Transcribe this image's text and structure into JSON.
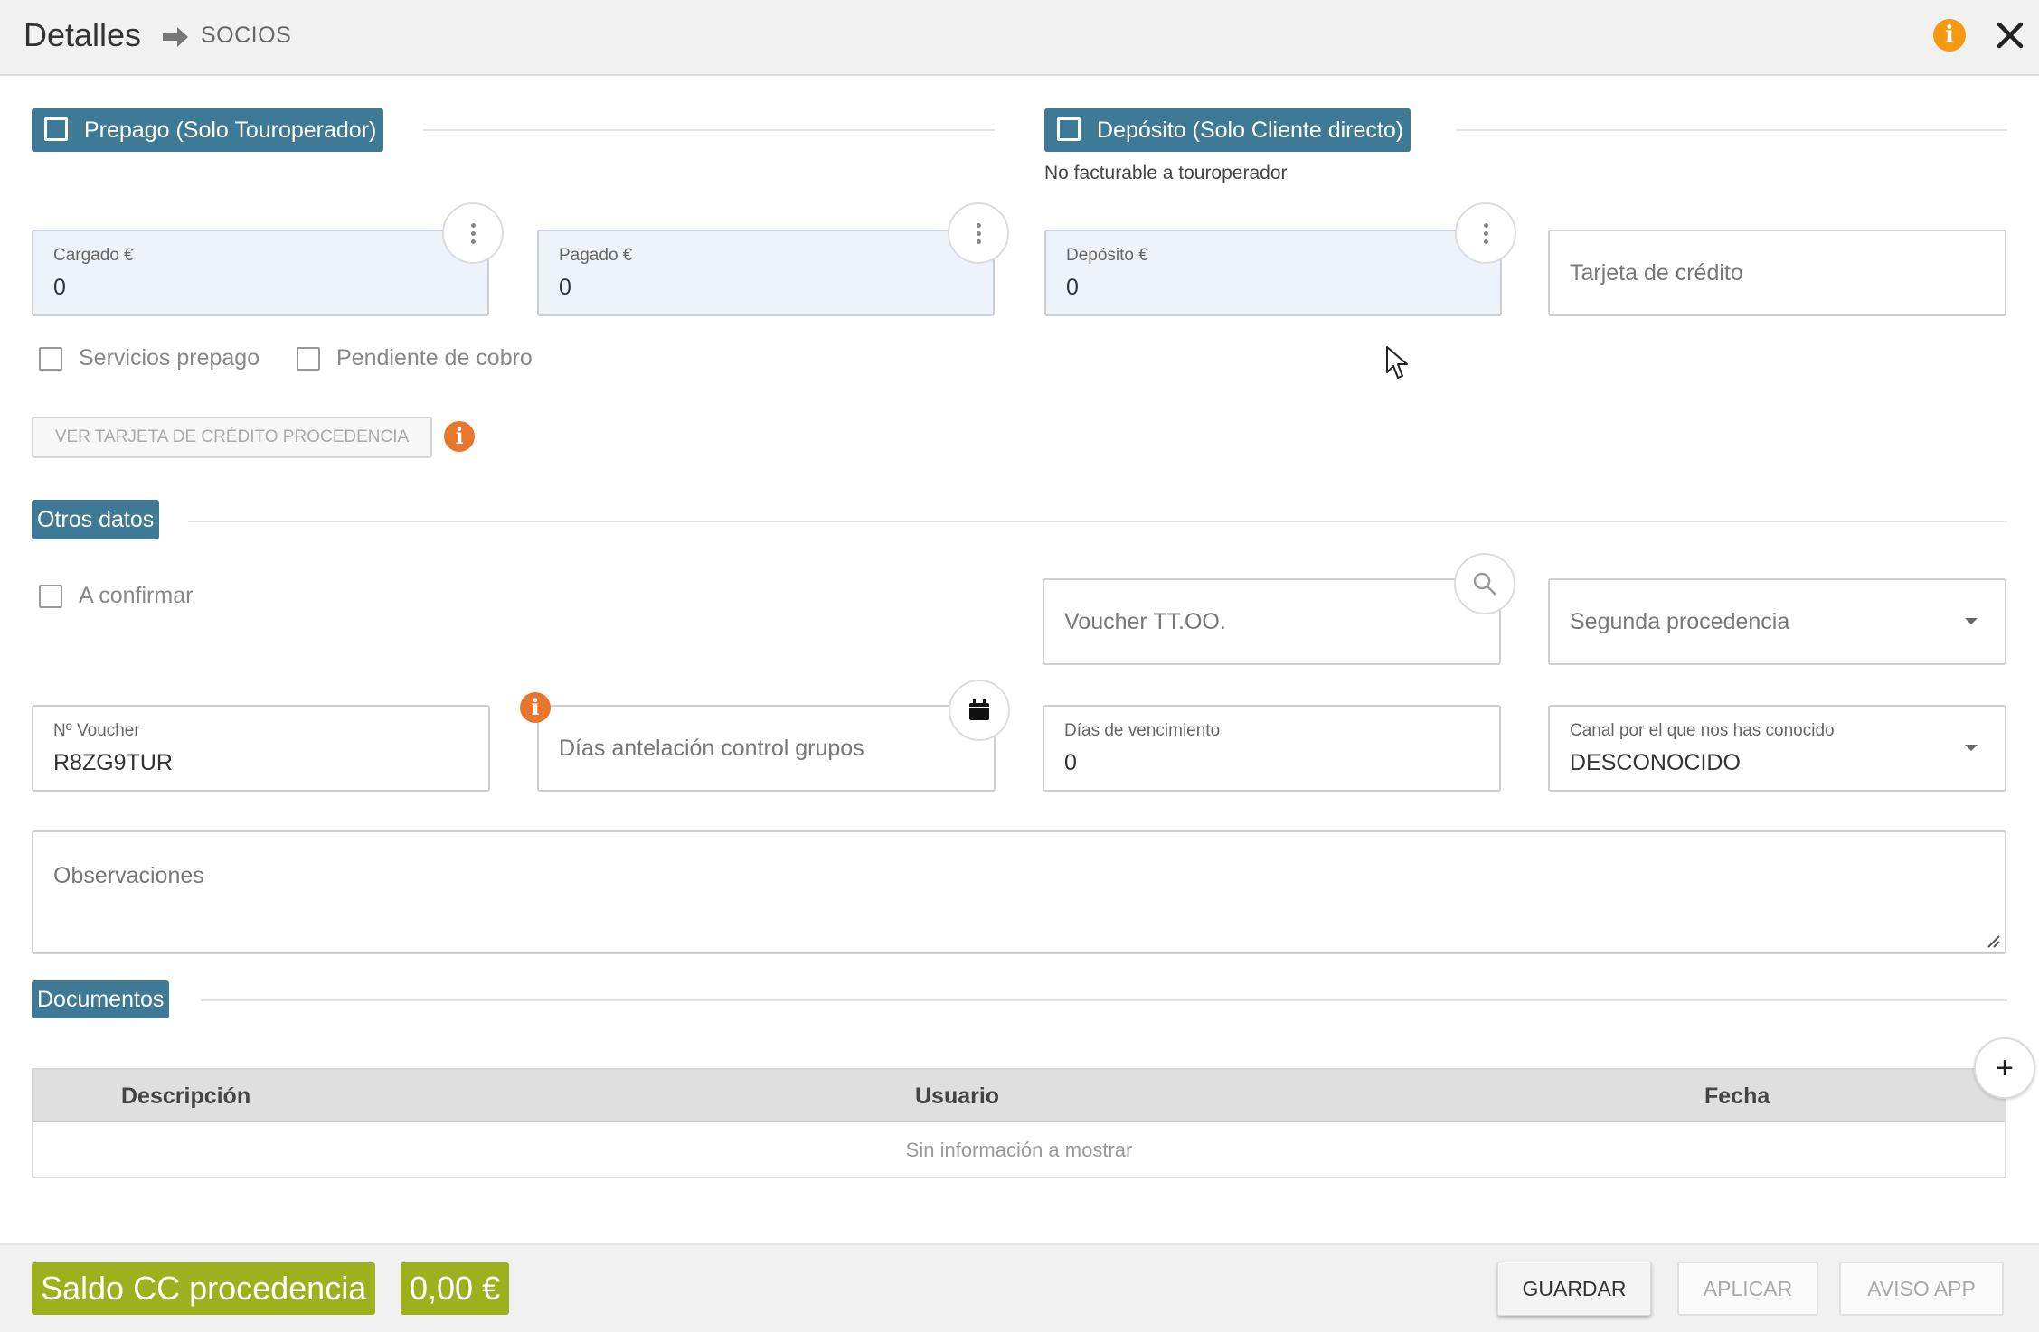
{
  "header": {
    "title": "Detalles",
    "breadcrumb": "SOCIOS"
  },
  "prepago": {
    "section_label": "Prepago (Solo Touroperador)",
    "cargado": {
      "label": "Cargado €",
      "value": "0"
    },
    "pagado": {
      "label": "Pagado €",
      "value": "0"
    },
    "servicios_prepago": "Servicios prepago",
    "pendiente_cobro": "Pendiente de cobro",
    "ver_tarjeta_button": "VER TARJETA DE CRÉDITO PROCEDENCIA"
  },
  "deposito": {
    "section_label": "Depósito (Solo Cliente directo)",
    "note": "No facturable a touroperador",
    "deposito_field": {
      "label": "Depósito €",
      "value": "0"
    },
    "tarjeta_placeholder": "Tarjeta de crédito"
  },
  "otros": {
    "section_label": "Otros datos",
    "a_confirmar": "A confirmar",
    "voucher_placeholder": "Voucher TT.OO.",
    "segunda_procedencia_placeholder": "Segunda procedencia",
    "n_voucher": {
      "label": "Nº Voucher",
      "value": "R8ZG9TUR"
    },
    "dias_antelacion_placeholder": "Días antelación control grupos",
    "dias_vencimiento": {
      "label": "Días de vencimiento",
      "value": "0"
    },
    "canal": {
      "label": "Canal por el que nos has conocido",
      "value": "DESCONOCIDO"
    },
    "observaciones_placeholder": "Observaciones"
  },
  "documentos": {
    "section_label": "Documentos",
    "columns": [
      "Descripción",
      "Usuario",
      "Fecha"
    ],
    "empty_text": "Sin información a mostrar"
  },
  "footer": {
    "saldo_label": "Saldo CC procedencia",
    "saldo_value": "0,00 €",
    "guardar": "GUARDAR",
    "aplicar": "APLICAR",
    "aviso_app": "AVISO APP"
  },
  "icons": {
    "header_info": "i",
    "inline_info": "i",
    "add": "+"
  },
  "colors": {
    "section_tag": "#3e7a95",
    "saldo": "#9cb11d",
    "info_header": "#f39a12",
    "info_inline": "#e8762d",
    "field_tint": "#eef3fa"
  }
}
